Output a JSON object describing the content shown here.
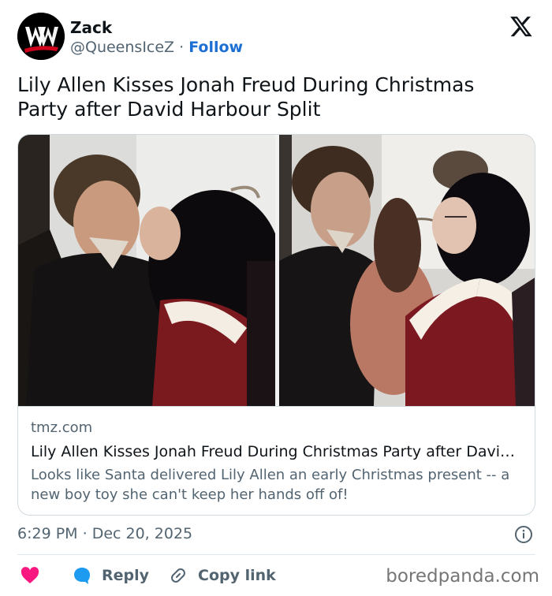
{
  "author": {
    "name": "Zack",
    "handle": "@QueensIceZ",
    "separator": "·",
    "follow_label": "Follow"
  },
  "tweet": {
    "text": "Lily Allen Kisses Jonah Freud During Christmas Party after David Harbour Split"
  },
  "card": {
    "domain": "tmz.com",
    "title": "Lily Allen Kisses Jonah Freud During Christmas Party after Davi…",
    "description": "Looks like Santa delivered Lily Allen an early Christmas present -- a new boy toy she can't keep her hands off of!"
  },
  "meta": {
    "time": "6:29 PM",
    "separator": "·",
    "date": "Dec 20, 2025"
  },
  "actions": {
    "reply_label": "Reply",
    "copy_label": "Copy link"
  },
  "icons": {
    "avatar": "wwe-logo",
    "platform": "x-icon",
    "info": "info-icon",
    "like": "heart-icon",
    "reply": "speech-bubble-icon",
    "copy": "link-icon"
  },
  "colors": {
    "follow": "#1d6fd4",
    "heart": "#f91880",
    "reply_icon": "#1d9bf0",
    "secondary_text": "#536471"
  },
  "watermark": "boredpanda.com"
}
